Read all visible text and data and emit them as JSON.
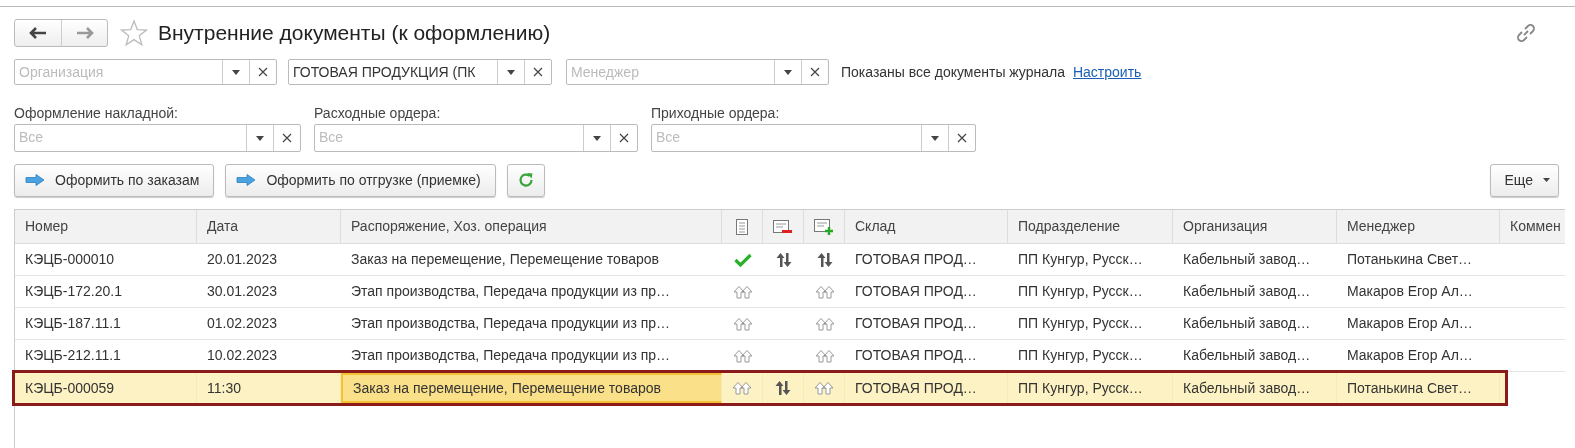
{
  "window": {
    "title": "Внутренние документы (к оформлению)"
  },
  "filters": [
    {
      "placeholder": "Организация"
    },
    {
      "value": "ГОТОВАЯ ПРОДУКЦИЯ (ПК"
    },
    {
      "placeholder": "Менеджер"
    }
  ],
  "filter_info": {
    "text": "Показаны все документы журнала",
    "link": "Настроить"
  },
  "selectors": [
    {
      "label": "Оформление накладной:",
      "placeholder": "Все"
    },
    {
      "label": "Расходные ордера:",
      "placeholder": "Все"
    },
    {
      "label": "Приходные ордера:",
      "placeholder": "Все"
    }
  ],
  "actions": [
    {
      "label": "Оформить по заказам"
    },
    {
      "label": "Оформить по отгрузке (приемке)"
    }
  ],
  "more_button": "Еще",
  "table": {
    "columns": [
      "Номер",
      "Дата",
      "Распоряжение, Хоз. операция",
      "Склад",
      "Подразделение",
      "Организация",
      "Менеджер",
      "Коммен"
    ],
    "rows": [
      {
        "number": "КЭЦБ-000010",
        "date": "20.01.2023",
        "operation": "Заказ на перемещение, Перемещение товаров",
        "status": [
          {
            "kind": "check"
          },
          {
            "kind": "exchange"
          },
          {
            "kind": "exchange"
          }
        ],
        "warehouse": "ГОТОВАЯ ПРОД…",
        "division": "ПП Кунгур, Русск…",
        "organization": "Кабельный завод…",
        "manager": "Потанькина Свет…",
        "selected": false,
        "focused": false,
        "framed": false
      },
      {
        "number": "КЭЦБ-172.20.1",
        "date": "30.01.2023",
        "operation": "Этап производства, Передача продукции из пр…",
        "status": [
          {
            "kind": "up"
          },
          {
            "kind": "empty"
          },
          {
            "kind": "up"
          }
        ],
        "warehouse": "ГОТОВАЯ ПРОД…",
        "division": "ПП Кунгур, Русск…",
        "organization": "Кабельный завод…",
        "manager": "Макаров Егор Ал…",
        "selected": false,
        "focused": false,
        "framed": false
      },
      {
        "number": "КЭЦБ-187.11.1",
        "date": "01.02.2023",
        "operation": "Этап производства, Передача продукции из пр…",
        "status": [
          {
            "kind": "up"
          },
          {
            "kind": "empty"
          },
          {
            "kind": "up"
          }
        ],
        "warehouse": "ГОТОВАЯ ПРОД…",
        "division": "ПП Кунгур, Русск…",
        "organization": "Кабельный завод…",
        "manager": "Макаров Егор Ал…",
        "selected": false,
        "focused": false,
        "framed": false
      },
      {
        "number": "КЭЦБ-212.11.1",
        "date": "10.02.2023",
        "operation": "Этап производства, Передача продукции из пр…",
        "status": [
          {
            "kind": "up"
          },
          {
            "kind": "empty"
          },
          {
            "kind": "up"
          }
        ],
        "warehouse": "ГОТОВАЯ ПРОД…",
        "division": "ПП Кунгур, Русск…",
        "organization": "Кабельный завод…",
        "manager": "Макаров Егор Ал…",
        "selected": false,
        "focused": false,
        "framed": false
      },
      {
        "number": "КЭЦБ-000059",
        "date": "11:30",
        "operation": "Заказ на перемещение, Перемещение товаров",
        "status": [
          {
            "kind": "up"
          },
          {
            "kind": "exchange"
          },
          {
            "kind": "up"
          }
        ],
        "warehouse": "ГОТОВАЯ ПРОД…",
        "division": "ПП Кунгур, Русск…",
        "organization": "Кабельный завод…",
        "manager": "Потанькина Свет…",
        "selected": true,
        "focused": true,
        "framed": true
      }
    ]
  }
}
